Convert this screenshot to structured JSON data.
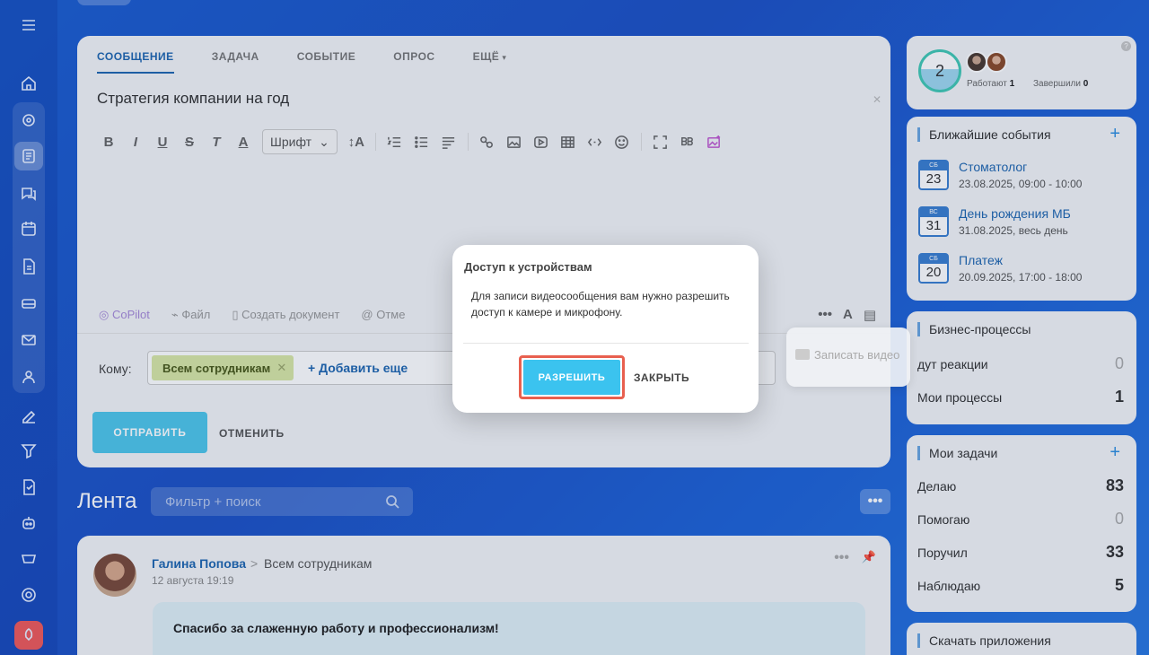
{
  "composer": {
    "tabs": [
      {
        "label": "СООБЩЕНИЕ"
      },
      {
        "label": "ЗАДАЧА"
      },
      {
        "label": "СОБЫТИЕ"
      },
      {
        "label": "ОПРОС"
      },
      {
        "label": "ЕЩЁ"
      }
    ],
    "title": "Стратегия компании на год",
    "font_select": "Шрифт",
    "attachments": {
      "copilot": "CoPilot",
      "file": "Файл",
      "create_doc": "Создать документ",
      "mention": "Отме"
    },
    "recipient_label": "Кому:",
    "recipient_chip": "Всем сотрудникам",
    "add_more": "+ Добавить еще",
    "send": "ОТПРАВИТЬ",
    "cancel": "ОТМЕНИТЬ"
  },
  "feed": {
    "title": "Лента",
    "search_placeholder": "Фильтр + поиск",
    "post": {
      "author": "Галина Попова",
      "arrow": ">",
      "target": "Всем сотрудникам",
      "time": "12 августа 19:19",
      "text": "Спасибо за слаженную работу и профессионализм!"
    }
  },
  "pulse": {
    "count": "2",
    "working_label": "Работают",
    "working_value": "1",
    "finished_label": "Завершили",
    "finished_value": "0",
    "help": "?"
  },
  "events": {
    "title": "Ближайшие события",
    "plus": "+",
    "items": [
      {
        "weekday": "СБ",
        "day": "23",
        "name": "Стоматолог",
        "date": "23.08.2025, 09:00 - 10:00"
      },
      {
        "weekday": "ВС",
        "day": "31",
        "name": "День рождения МБ",
        "date": "31.08.2025, весь день"
      },
      {
        "weekday": "СБ",
        "day": "20",
        "name": "Платеж",
        "date": "20.09.2025, 17:00 - 18:00"
      }
    ]
  },
  "bp": {
    "title": "Бизнес-процессы",
    "rows": [
      {
        "label": "дут реакции",
        "value": "0"
      },
      {
        "label": "Мои процессы",
        "value": "1"
      }
    ]
  },
  "tasks": {
    "title": "Мои задачи",
    "plus": "+",
    "rows": [
      {
        "label": "Делаю",
        "value": "83"
      },
      {
        "label": "Помогаю",
        "value": "0"
      },
      {
        "label": "Поручил",
        "value": "33"
      },
      {
        "label": "Наблюдаю",
        "value": "5"
      }
    ]
  },
  "apps": {
    "title": "Скачать приложения"
  },
  "video_popup": {
    "label": "Записать видео"
  },
  "dialog": {
    "title": "Доступ к устройствам",
    "text": "Для записи видеосообщения вам нужно разрешить доступ к камере и микрофону.",
    "allow": "РАЗРЕШИТЬ",
    "close": "ЗАКРЫТЬ"
  },
  "colors": {
    "accent": "#2067b0",
    "allow_button": "#3bc3ef",
    "highlight_ring": "#e8604f",
    "send_button": "#4fc6ea"
  }
}
